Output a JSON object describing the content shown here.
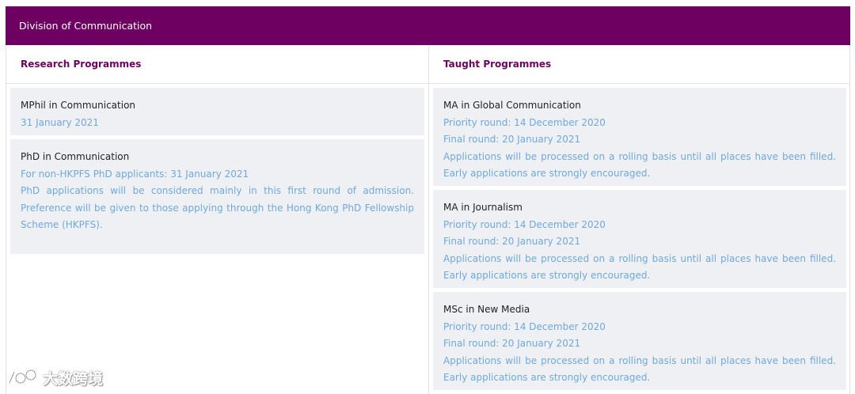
{
  "header": {
    "title": "Division of Communication"
  },
  "columns": {
    "research": {
      "title": "Research Programmes",
      "cards": [
        {
          "name": "MPhil in Communication",
          "lines": [
            "31 January 2021"
          ]
        },
        {
          "name": "PhD in Communication",
          "lines": [
            "For non-HKPFS PhD applicants: 31 January 2021",
            "PhD applications will be considered mainly in this first round of admission. Preference will be given to those applying through the Hong Kong PhD Fellowship Scheme (HKPFS)."
          ]
        }
      ]
    },
    "taught": {
      "title": "Taught Programmes",
      "cards": [
        {
          "name": "MA in Global Communication",
          "lines": [
            "Priority round: 14 December 2020",
            "Final round: 20 January 2021",
            "Applications will be processed on a rolling basis until all places have been filled. Early applications are strongly encouraged."
          ]
        },
        {
          "name": "MA in Journalism",
          "lines": [
            "Priority round: 14 December 2020",
            "Final round: 20 January 2021",
            "Applications will be processed on a rolling basis until all places have been filled. Early applications are strongly encouraged."
          ]
        },
        {
          "name": "MSc in New Media",
          "lines": [
            "Priority round: 14 December 2020",
            "Final round: 20 January 2021",
            "Applications will be processed on a rolling basis until all places have been filled. Early applications are strongly encouraged."
          ]
        }
      ]
    }
  },
  "watermark": {
    "text": "大数跨境",
    "icon": "logo-icon"
  },
  "colors": {
    "header_bg": "#6e0062",
    "title": "#6e0062",
    "info": "#6fa9dc",
    "card_bg": "#eef0f4"
  }
}
